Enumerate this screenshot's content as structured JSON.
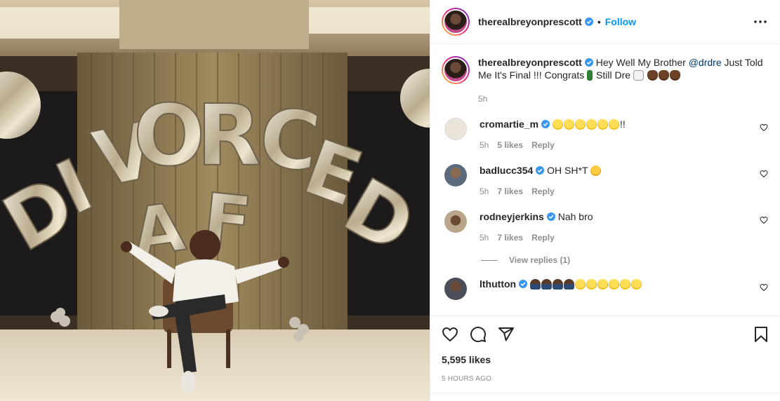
{
  "post": {
    "author": "therealbreyonprescott",
    "follow_label": "Follow",
    "separator": "•",
    "caption": {
      "username": "therealbreyonprescott",
      "text_before": "Hey Well My Brother ",
      "mention": "@drdre",
      "text_after": " Just Told Me It's Final !!! Congrats ",
      "text_after2": " Still Dre ",
      "time": "5h"
    },
    "comments": [
      {
        "username": "cromartie_m",
        "text": "!!",
        "time": "5h",
        "likes": "5 likes",
        "reply": "Reply",
        "avatar_color": "#e9e3da"
      },
      {
        "username": "badlucc354",
        "text": "OH SH*T",
        "time": "5h",
        "likes": "7 likes",
        "reply": "Reply",
        "avatar_color": "#5b6a7c"
      },
      {
        "username": "rodneyjerkins",
        "text": "Nah bro",
        "time": "5h",
        "likes": "7 likes",
        "reply": "Reply",
        "avatar_color": "#b8a58a"
      },
      {
        "username": "lthutton",
        "text": "",
        "time": "",
        "likes": "",
        "reply": "",
        "avatar_color": "#4a4e58"
      }
    ],
    "view_replies": "View replies (1)",
    "likes": "5,595 likes",
    "posted": "5 HOURS AGO"
  },
  "icons": {
    "more": "more-options-icon",
    "like": "heart-icon",
    "comment": "comment-icon",
    "share": "share-icon",
    "save": "bookmark-icon",
    "verified": "verified-badge-icon"
  },
  "colors": {
    "accent": "#0095f6",
    "verified": "#3897f0",
    "mention": "#00376b",
    "muted": "#8e8e8e",
    "border": "#efefef"
  },
  "photo": {
    "balloon_letters_top": "DIVORCED",
    "balloon_letters_bottom": "AF"
  }
}
